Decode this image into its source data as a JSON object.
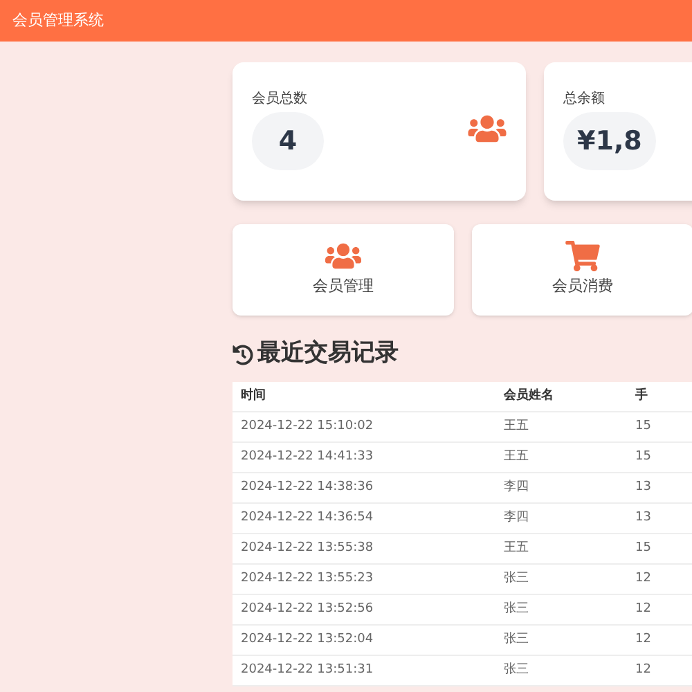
{
  "header": {
    "title": "会员管理系统"
  },
  "stats": [
    {
      "label": "会员总数",
      "value": "4",
      "kind": "users"
    },
    {
      "label": "总余额",
      "value": "¥1,8",
      "kind": "none"
    }
  ],
  "actions": [
    {
      "label": "会员管理",
      "kind": "users"
    },
    {
      "label": "会员消费",
      "kind": "cart"
    }
  ],
  "section_title": "最近交易记录",
  "table": {
    "columns": [
      "时间",
      "会员姓名",
      "手"
    ],
    "rows": [
      [
        "2024-12-22 15:10:02",
        "王五",
        "15"
      ],
      [
        "2024-12-22 14:41:33",
        "王五",
        "15"
      ],
      [
        "2024-12-22 14:38:36",
        "李四",
        "13"
      ],
      [
        "2024-12-22 14:36:54",
        "李四",
        "13"
      ],
      [
        "2024-12-22 13:55:38",
        "王五",
        "15"
      ],
      [
        "2024-12-22 13:55:23",
        "张三",
        "12"
      ],
      [
        "2024-12-22 13:52:56",
        "张三",
        "12"
      ],
      [
        "2024-12-22 13:52:04",
        "张三",
        "12"
      ],
      [
        "2024-12-22 13:51:31",
        "张三",
        "12"
      ]
    ]
  }
}
